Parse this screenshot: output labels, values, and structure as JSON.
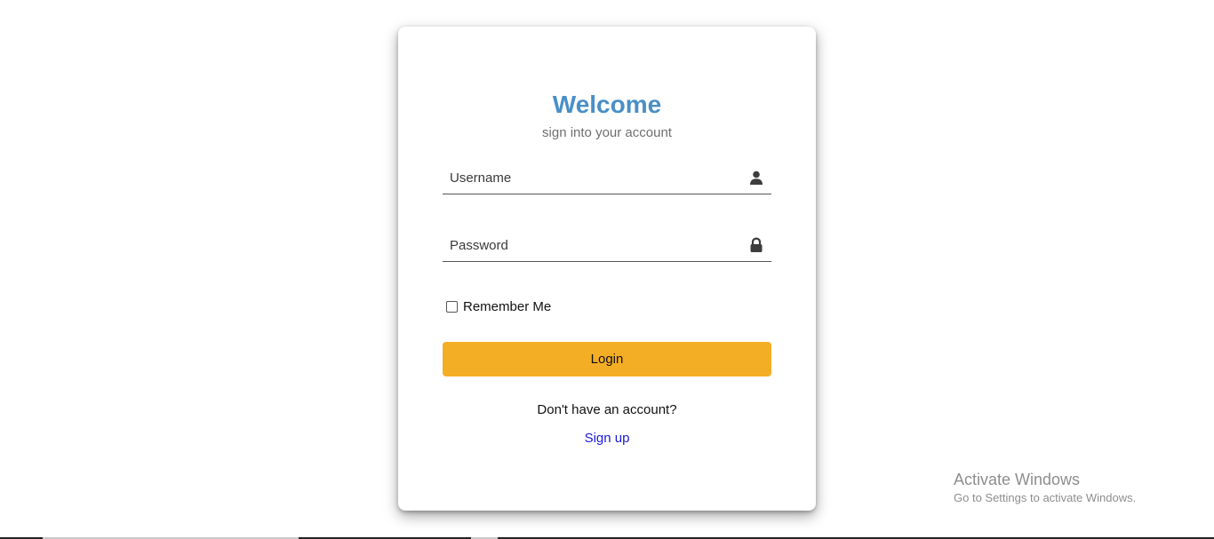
{
  "login": {
    "title": "Welcome",
    "subtitle": "sign into your account",
    "username": {
      "placeholder": "Username",
      "value": "",
      "icon": "user-icon"
    },
    "password": {
      "placeholder": "Password",
      "value": "",
      "icon": "lock-icon"
    },
    "remember_label": "Remember Me",
    "remember_checked": false,
    "login_label": "Login",
    "no_account_text": "Don't have an account?",
    "signup_label": "Sign up"
  },
  "watermark": {
    "title": "Activate Windows",
    "subtitle": "Go to Settings to activate Windows."
  },
  "colors": {
    "title": "#4a8fc7",
    "login_button": "#f4ae26",
    "signup_link": "#1a1adb"
  }
}
